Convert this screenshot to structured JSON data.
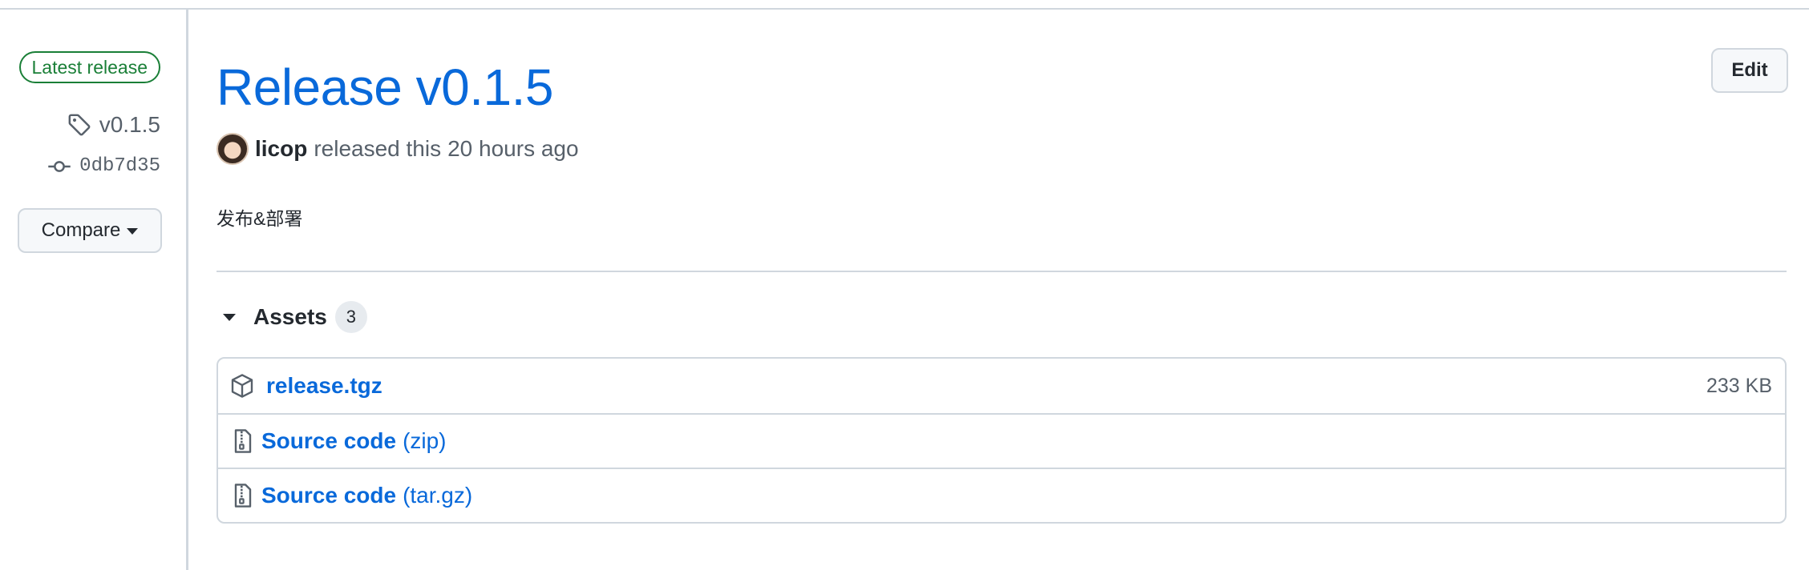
{
  "sidebar": {
    "latest_badge": "Latest release",
    "tag": "v0.1.5",
    "commit": "0db7d35",
    "compare_label": "Compare"
  },
  "release": {
    "title": "Release v0.1.5",
    "edit_label": "Edit",
    "author": "licop",
    "released_text": "released this",
    "time": "20 hours ago",
    "notes": "发布&部署"
  },
  "assets": {
    "heading": "Assets",
    "count": "3",
    "items": [
      {
        "name": "release.tgz",
        "suffix": "",
        "size": "233 KB",
        "icon": "package-icon"
      },
      {
        "name": "Source code",
        "suffix": "(zip)",
        "size": "",
        "icon": "file-zip-icon"
      },
      {
        "name": "Source code",
        "suffix": "(tar.gz)",
        "size": "",
        "icon": "file-zip-icon"
      }
    ]
  },
  "colors": {
    "link": "#0969da",
    "latest_green": "#1a7f37",
    "border": "#d0d7de",
    "muted": "#57606a"
  }
}
